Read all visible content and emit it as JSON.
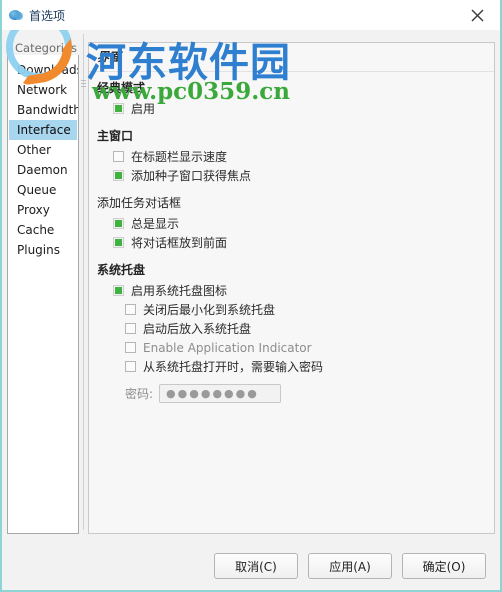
{
  "window": {
    "title": "首选项",
    "icon": "water-drop-icon",
    "close_label": "×",
    "border_color": "#8fd4d4"
  },
  "watermark": {
    "site_name": "河东软件园",
    "url": "www.pc0359.cn",
    "logo": "pc0359-logo"
  },
  "categories": {
    "legend": "Categories",
    "selected": "Interface",
    "items": [
      {
        "label": "Downloads"
      },
      {
        "label": "Network"
      },
      {
        "label": "Bandwidth"
      },
      {
        "label": "Interface"
      },
      {
        "label": "Other"
      },
      {
        "label": "Daemon"
      },
      {
        "label": "Queue"
      },
      {
        "label": "Proxy"
      },
      {
        "label": "Cache"
      },
      {
        "label": "Plugins"
      }
    ]
  },
  "panel": {
    "header": "界面",
    "groups": [
      {
        "title": "经典模式",
        "bold": true,
        "options": [
          {
            "label": "启用",
            "checked": true,
            "sub": false,
            "dim": false
          }
        ]
      },
      {
        "title": "主窗口",
        "bold": true,
        "options": [
          {
            "label": "在标题栏显示速度",
            "checked": false,
            "sub": false,
            "dim": false
          },
          {
            "label": "添加种子窗口获得焦点",
            "checked": true,
            "sub": false,
            "dim": false
          }
        ]
      },
      {
        "title": "添加任务对话框",
        "bold": false,
        "options": [
          {
            "label": "总是显示",
            "checked": true,
            "sub": false,
            "dim": false
          },
          {
            "label": "将对话框放到前面",
            "checked": true,
            "sub": false,
            "dim": false
          }
        ]
      },
      {
        "title": "系统托盘",
        "bold": true,
        "options": [
          {
            "label": "启用系统托盘图标",
            "checked": true,
            "sub": false,
            "dim": false
          },
          {
            "label": "关闭后最小化到系统托盘",
            "checked": false,
            "sub": true,
            "dim": false
          },
          {
            "label": "启动后放入系统托盘",
            "checked": false,
            "sub": true,
            "dim": false
          },
          {
            "label": "Enable Application Indicator",
            "checked": false,
            "sub": true,
            "dim": true
          },
          {
            "label": "从系统托盘打开时，需要输入密码",
            "checked": false,
            "sub": true,
            "dim": false
          }
        ],
        "password_field": {
          "label": "密码:",
          "value": "●●●●●●●●"
        }
      }
    ]
  },
  "footer": {
    "buttons": [
      {
        "label": "取消(C)",
        "name": "cancel-button"
      },
      {
        "label": "应用(A)",
        "name": "apply-button"
      },
      {
        "label": "确定(O)",
        "name": "ok-button"
      }
    ]
  }
}
